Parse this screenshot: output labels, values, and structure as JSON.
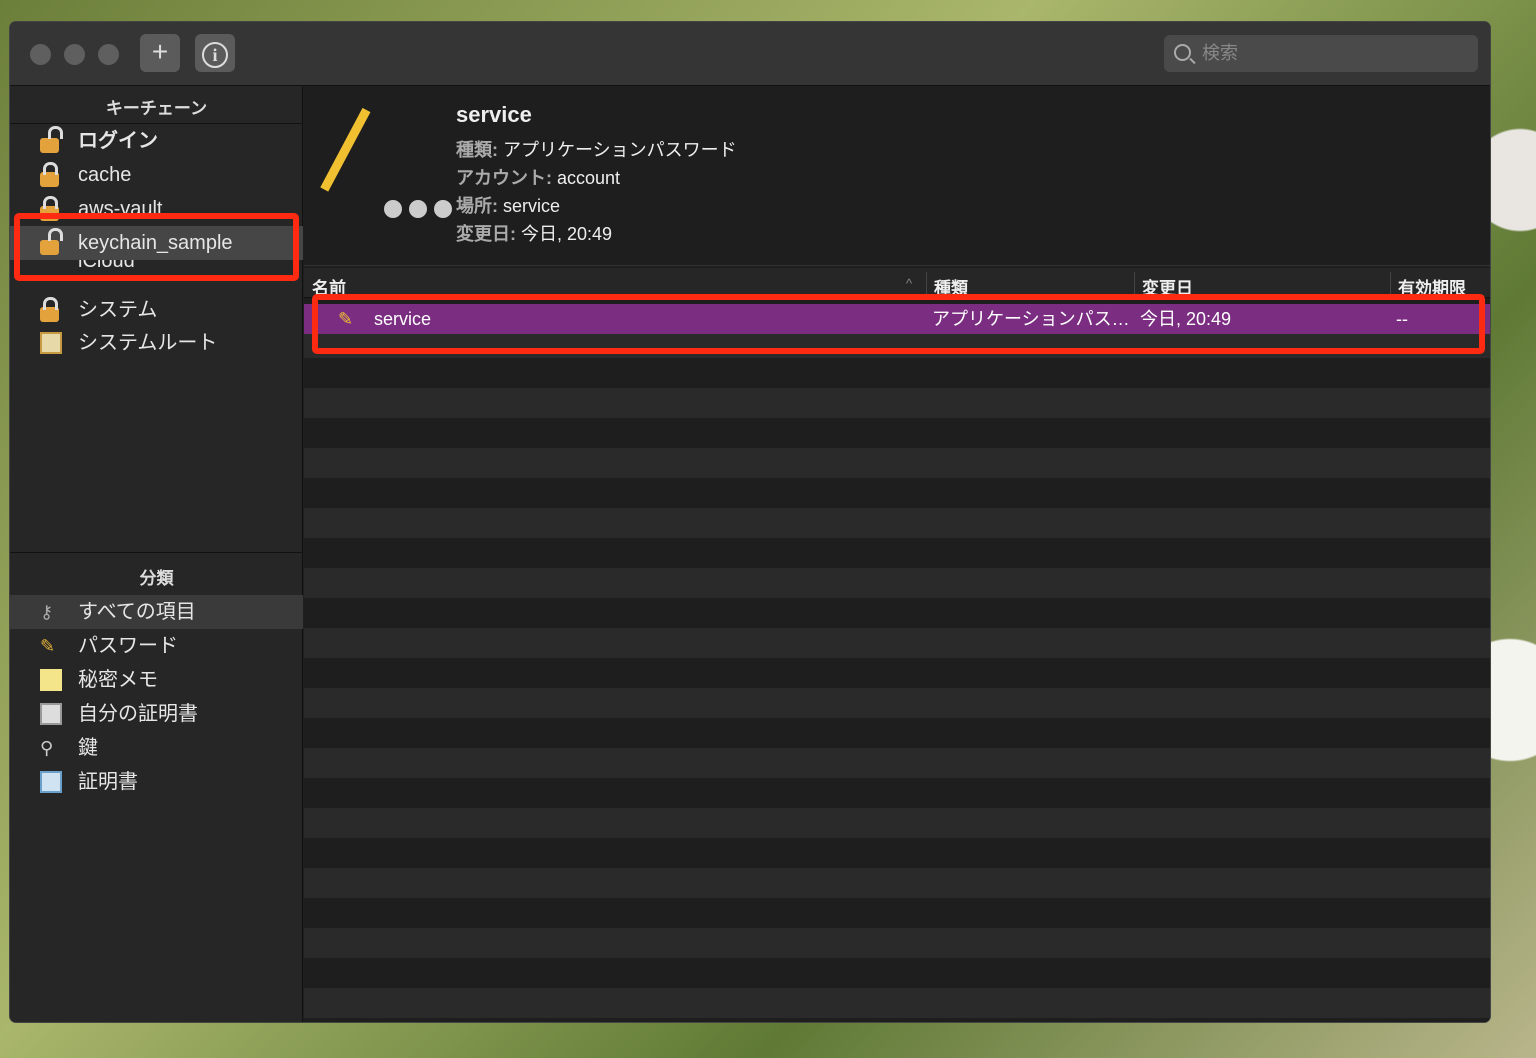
{
  "toolbar": {
    "add_label": "+",
    "info_label": "i",
    "search_placeholder": "検索"
  },
  "sidebar": {
    "keychain_header": "キーチェーン",
    "keychains": [
      {
        "label": "ログイン",
        "icon": "lock-open-icon"
      },
      {
        "label": "cache",
        "icon": "lock-icon"
      },
      {
        "label": "aws-vault",
        "icon": "lock-icon"
      },
      {
        "label": "keychain_sample",
        "icon": "lock-open-icon",
        "selected": true
      },
      {
        "label": "iCloud",
        "icon": "cloud-icon"
      },
      {
        "label": "システム",
        "icon": "lock-icon"
      },
      {
        "label": "システムルート",
        "icon": "certificate-icon"
      }
    ],
    "category_header": "分類",
    "categories": [
      {
        "label": "すべての項目",
        "icon": "keys-icon",
        "selected": true
      },
      {
        "label": "パスワード",
        "icon": "pencil-icon"
      },
      {
        "label": "秘密メモ",
        "icon": "note-icon"
      },
      {
        "label": "自分の証明書",
        "icon": "certificate-icon"
      },
      {
        "label": "鍵",
        "icon": "key-icon"
      },
      {
        "label": "証明書",
        "icon": "certificate-icon"
      }
    ]
  },
  "detail": {
    "title": "service",
    "kind_label": "種類:",
    "kind": "アプリケーションパスワード",
    "account_label": "アカウント:",
    "account": "account",
    "where_label": "場所:",
    "where": "service",
    "modified_label": "変更日:",
    "modified": "今日, 20:49"
  },
  "table": {
    "columns": [
      "名前",
      "種類",
      "変更日",
      "有効期限"
    ],
    "rows": [
      {
        "name": "service",
        "kind": "アプリケーションパス…",
        "modified": "今日, 20:49",
        "expires": "--",
        "selected": true
      }
    ]
  },
  "colors": {
    "selection": "#7b2d82",
    "annotation": "#ff2a12"
  }
}
